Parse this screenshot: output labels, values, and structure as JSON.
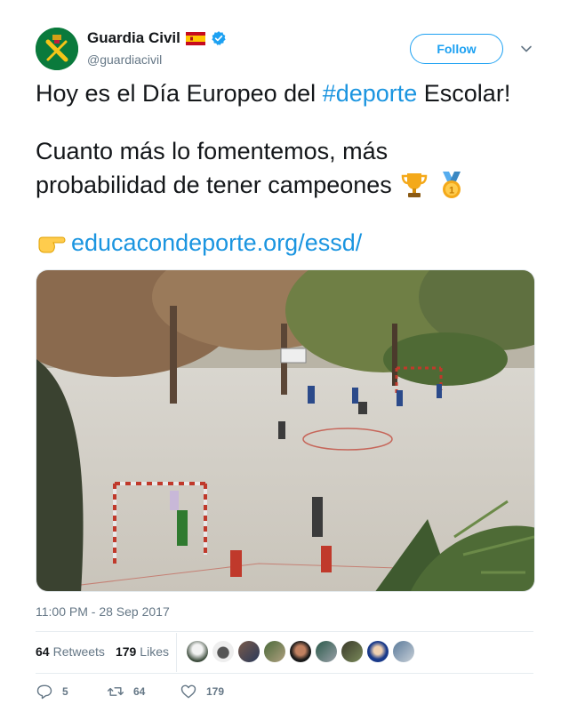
{
  "author": {
    "display_name": "Guardia Civil",
    "handle": "@guardiacivil",
    "verified": true,
    "flag": "spain-flag-icon"
  },
  "follow_button": {
    "label": "Follow"
  },
  "tweet": {
    "line1_pre": "Hoy es el Día Europeo del ",
    "hashtag": "#deporte",
    "line1_post": " Escolar!",
    "line2": "Cuanto más lo fomentemos, más",
    "line3": "probabilidad de tener campeones",
    "line3_emojis": [
      "trophy-icon",
      "medal-icon"
    ],
    "link_emoji": "pointing-hand-icon",
    "link": "educacondeporte.org/essd/"
  },
  "timestamp": "11:00 PM - 28 Sep 2017",
  "stats": {
    "retweets_count": "64",
    "retweets_label": "Retweets",
    "likes_count": "179",
    "likes_label": "Likes"
  },
  "actions": {
    "replies": "5",
    "retweets": "64",
    "likes": "179"
  },
  "colors": {
    "link": "#1b95e0",
    "follow_border": "#1da1f2",
    "muted": "#657786",
    "avatar_bg": "#0a7a3c"
  }
}
